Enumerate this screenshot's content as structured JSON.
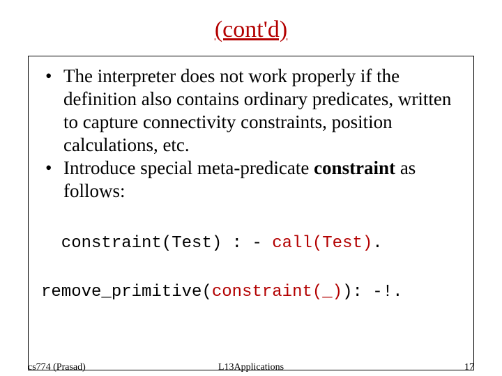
{
  "title": "(cont'd)",
  "bullets": {
    "b1": "The interpreter does not work properly if the definition also contains ordinary predicates, written to capture connectivity constraints, position calculations, etc.",
    "b2_prefix": "Introduce special meta-predicate ",
    "b2_bold": "constraint",
    "b2_suffix": " as follows:"
  },
  "code": {
    "line1_pre": "  constraint(Test) : - ",
    "line1_call": "call(Test)",
    "line1_post": ".",
    "line2_pre": "remove_primitive(",
    "line2_mid": "constraint(_)",
    "line2_post": "): -!."
  },
  "footer": {
    "left": "cs774 (Prasad)",
    "center": "L13Applications",
    "right": "17"
  }
}
